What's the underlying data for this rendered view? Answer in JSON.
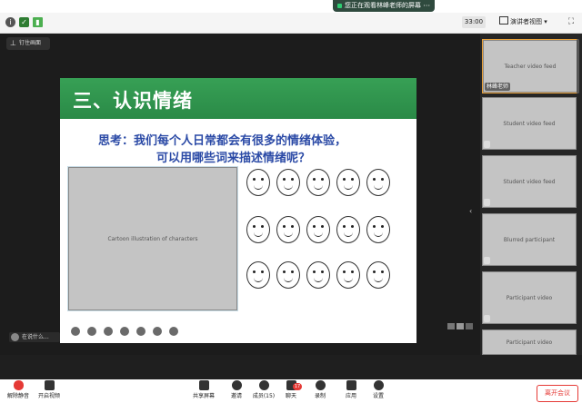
{
  "banner": {
    "text": "您正在观看林峰老师的屏幕",
    "more": "···"
  },
  "topbar": {
    "timer": "33:00",
    "view_option": "演讲者视图",
    "view_caret": "▾"
  },
  "pinbar": {
    "label": "钉住画面"
  },
  "slide": {
    "title": "三、认识情绪",
    "question_line1": "思考：我们每个人日常都会有很多的情绪体验，",
    "question_line2": "可以用哪些词来描述情绪呢？",
    "illustration_label": "Cartoon illustration of characters"
  },
  "annotation": {
    "text": "在说什么..."
  },
  "participants": [
    {
      "name": "林峰老师",
      "photo": "Teacher video feed"
    },
    {
      "name": "",
      "photo": "Student video feed"
    },
    {
      "name": "",
      "photo": "Student video feed"
    },
    {
      "name": "",
      "photo": "Blurred participant"
    },
    {
      "name": "",
      "photo": "Participant video"
    },
    {
      "name": "",
      "photo": "Participant video"
    }
  ],
  "bottombar": {
    "unmute": "解除静音",
    "start_video": "开启视频",
    "share_screen": "共享屏幕",
    "invite": "邀请",
    "members": "成员(15)",
    "chat": "聊天",
    "chat_badge": "17",
    "record": "录制",
    "apps": "应用",
    "settings": "设置",
    "leave": "离开会议"
  },
  "colors": {
    "accent_green": "#2a8a47",
    "leave_red": "#e53935",
    "question_blue": "#2b4aa6"
  }
}
